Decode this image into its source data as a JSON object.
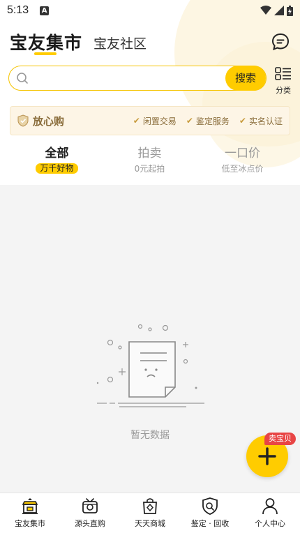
{
  "status": {
    "time": "5:13"
  },
  "header": {
    "title": "宝友集市",
    "sub_title": "宝友社区"
  },
  "search": {
    "placeholder": "",
    "button_label": "搜索",
    "category_label": "分类"
  },
  "assurance": {
    "title": "放心购",
    "features": [
      "闲置交易",
      "鉴定服务",
      "实名认证"
    ]
  },
  "tabs": [
    {
      "title": "全部",
      "subtitle": "万千好物"
    },
    {
      "title": "拍卖",
      "subtitle": "0元起拍"
    },
    {
      "title": "一口价",
      "subtitle": "低至冰点价"
    }
  ],
  "empty_message": "暂无数据",
  "fab": {
    "badge": "卖宝贝"
  },
  "bottom_nav": [
    {
      "label": "宝友集市",
      "icon": "market-icon"
    },
    {
      "label": "源头直购",
      "icon": "camera-shop-icon"
    },
    {
      "label": "天天商城",
      "icon": "shopping-bag-icon"
    },
    {
      "label": "鉴定 · 回收",
      "icon": "appraise-shield-icon"
    },
    {
      "label": "个人中心",
      "icon": "person-icon"
    }
  ],
  "colors": {
    "accent": "#ffcc00",
    "badge": "#e84545",
    "assure_text": "#8a6d3b"
  }
}
